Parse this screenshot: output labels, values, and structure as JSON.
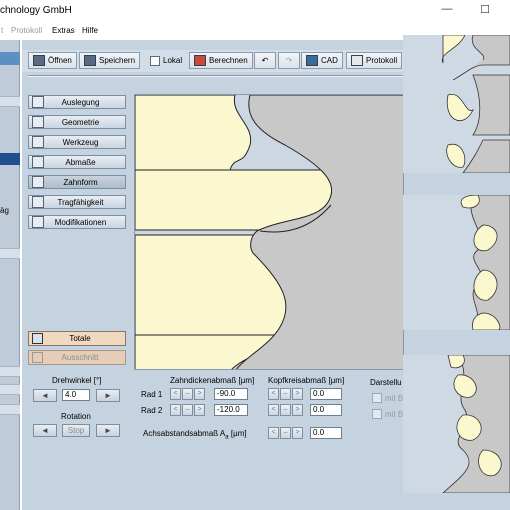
{
  "window": {
    "title": "chnology GmbH",
    "minimize_glyph": "—",
    "maximize_glyph": "☐"
  },
  "menu": {
    "items": [
      {
        "label": "t",
        "disabled": true
      },
      {
        "label": "Protokoll",
        "disabled": true
      },
      {
        "label": "Extras",
        "disabled": false
      },
      {
        "label": "Hilfe",
        "disabled": false
      }
    ]
  },
  "sidebar": {
    "partial_text": "äg"
  },
  "toolbar": {
    "open_label": "Öffnen",
    "save_label": "Speichern",
    "local_label": "Lokal",
    "calc_label": "Berechnen",
    "undo_glyph": "↶",
    "redo_glyph": "↷",
    "cad_label": "CAD",
    "protocol_label": "Protokoll"
  },
  "nav": {
    "items": [
      "Auslegung",
      "Geometrie",
      "Werkzeug",
      "Abmaße",
      "Zahnform",
      "Tragfähigkeit",
      "Modifikationen"
    ],
    "totale_label": "Totale",
    "ausschnitt_label": "Ausschnitt"
  },
  "rotation": {
    "drehwinkel_label": "Drehwinkel [°]",
    "drehwinkel_value": "4.0",
    "rotation_label": "Rotation",
    "stop_label": "Stop"
  },
  "deviations": {
    "zahndicken_header": "Zahndickenabmaß [µm]",
    "kopfkreis_header": "Kopfkreisabmaß [µm]",
    "rad1_label": "Rad 1",
    "rad2_label": "Rad 2",
    "rad1_zahndicken": "-90.0",
    "rad2_zahndicken": "-120.0",
    "rad1_kopfkreis": "0.0",
    "rad2_kopfkreis": "0.0",
    "achsabstand_label": "Achsabstandsabmaß A",
    "achsabstand_sub": "a",
    "achsabstand_unit": "[µm]",
    "achsabstand_value": "0.0",
    "spin_left": "<",
    "spin_mid": "–",
    "spin_right": ">"
  },
  "display": {
    "header": "Darstellu",
    "option1": "mit B",
    "option2": "mit B"
  },
  "colors": {
    "gear_fill": "#c8c8c8",
    "mating_fill": "#fbf7cf",
    "canvas_bg": "#ccd7e2",
    "selected_blue": "#1f4f8c"
  }
}
